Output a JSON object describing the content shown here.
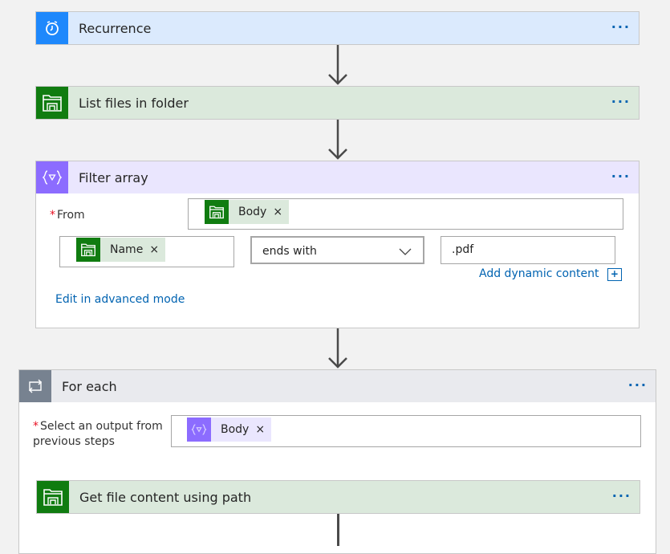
{
  "colors": {
    "schedule": "#1e88fc",
    "schedule_bg": "#dbeafd",
    "file": "#107c10",
    "file_bg": "#dbe9dc",
    "data_op": "#8c6cff",
    "data_op_bg": "#eae6fe",
    "control": "#778290",
    "control_bg": "#e9eaee",
    "link": "#0063b1"
  },
  "steps": {
    "recurrence": {
      "title": "Recurrence",
      "icon": "alarm-clock-icon",
      "more": "···"
    },
    "list_files": {
      "title": "List files in folder",
      "icon": "file-system-icon",
      "more": "···"
    },
    "filter_array": {
      "title": "Filter array",
      "icon": "filter-braces-icon",
      "more": "···",
      "from_label": "From",
      "required_mark": "*",
      "from_token": {
        "label": "Body",
        "remove": "×"
      },
      "condition_left_token": {
        "label": "Name",
        "remove": "×"
      },
      "operator": {
        "selected": "ends with"
      },
      "condition_value": ".pdf",
      "add_dynamic_content": "Add dynamic content",
      "add_dynamic_icon": "+",
      "advanced_mode_link": "Edit in advanced mode"
    },
    "for_each": {
      "title": "For each",
      "icon": "loop-icon",
      "more": "···",
      "required_mark": "*",
      "select_label_line1": "Select an output from",
      "select_label_line2": "previous steps",
      "token": {
        "label": "Body",
        "remove": "×"
      }
    },
    "get_file_content": {
      "title": "Get file content using path",
      "icon": "file-system-icon",
      "more": "···"
    }
  }
}
